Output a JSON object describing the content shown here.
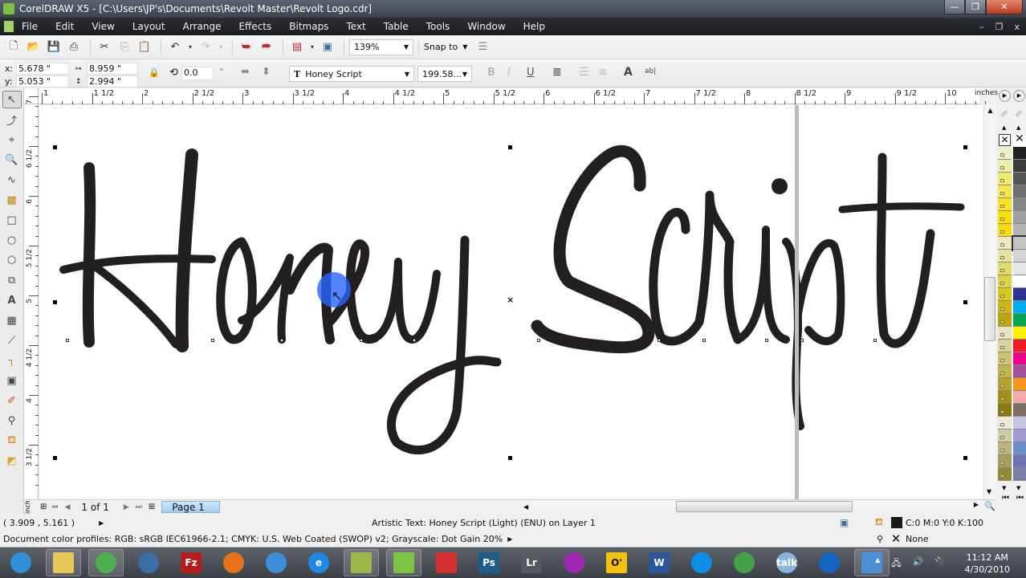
{
  "window": {
    "title": "CorelDRAW X5 - [C:\\Users\\JP's\\Documents\\Revolt Master\\Revolt Logo.cdr]",
    "minimize": "—",
    "maximize": "❐",
    "close": "✕"
  },
  "menu": {
    "items": [
      "File",
      "Edit",
      "View",
      "Layout",
      "Arrange",
      "Effects",
      "Bitmaps",
      "Text",
      "Table",
      "Tools",
      "Window",
      "Help"
    ],
    "doc_controls": [
      "–",
      "❐",
      "x"
    ]
  },
  "toolbar": {
    "icons": [
      "new-icon",
      "open-icon",
      "save-icon",
      "print-icon",
      "cut-icon",
      "copy-icon",
      "paste-icon",
      "undo-icon",
      "redo-icon",
      "import-icon",
      "export-icon",
      "application-launcher-icon",
      "welcome-screen-icon"
    ],
    "zoom_level": "139%",
    "snap_to": "Snap to"
  },
  "property_bar": {
    "x_label": "x:",
    "x_value": "5.678 \"",
    "y_label": "y:",
    "y_value": "5.053 \"",
    "width_value": "8.959 \"",
    "height_value": "2.994 \"",
    "rotation_value": "0.0",
    "degree_symbol": "°",
    "font_name": "Honey Script",
    "font_size": "199.58..."
  },
  "ruler": {
    "h_labels": [
      "1",
      "1 1/2",
      "2",
      "2 1/2",
      "3",
      "3 1/2",
      "4",
      "4 1/2",
      "5",
      "5 1/2",
      "6",
      "6 1/2",
      "7",
      "7 1/2",
      "8",
      "8 1/2",
      "9",
      "9 1/2",
      "10"
    ],
    "v_labels": [
      "7",
      "6 1/2",
      "6",
      "5 1/2",
      "5",
      "4 1/2",
      "4",
      "3 1/2"
    ],
    "units": "inches"
  },
  "canvas": {
    "artistic_text": "Honey Script",
    "word1": "Honey",
    "word2": "Script",
    "text_color": "#231f20"
  },
  "tools": [
    "pick-tool",
    "shape-tool",
    "crop-tool",
    "zoom-tool",
    "freehand-tool",
    "smart-fill-tool",
    "rectangle-tool",
    "ellipse-tool",
    "polygon-tool",
    "basic-shapes-tool",
    "text-tool",
    "table-tool",
    "dimension-tool",
    "connector-tool",
    "blend-tool",
    "eyedropper-tool",
    "outline-tool",
    "fill-tool",
    "interactive-fill-tool"
  ],
  "palette": {
    "col1": [
      "#f1f1c9",
      "#eeeea0",
      "#f0ec70",
      "#f4e94a",
      "#f8e31c",
      "#fbe000",
      "#fddc00",
      "#eceac0",
      "#e6e49a",
      "#e1dc6a",
      "#ddd348",
      "#d8c91e",
      "#cbb814",
      "#bda50a",
      "#e8e6c2",
      "#d9d49a",
      "#cdc46e",
      "#c2b548",
      "#b5a32a",
      "#a39114",
      "#8c7b0a",
      "#ecebd8",
      "#cfcca2",
      "#bdb67c",
      "#a8a05a",
      "#948a36"
    ],
    "col2": [
      "#231f20",
      "#3c3c3c",
      "#555555",
      "#6e6e6e",
      "#878787",
      "#a0a0a0",
      "#b4b4b4",
      "#c3c3c3",
      "#d4d4d4",
      "#e6e6e6",
      "#ffffff",
      "#2e3192",
      "#00aeef",
      "#00a651",
      "#fff200",
      "#ed1c24",
      "#ec008c",
      "#a3509f",
      "#f7941d",
      "#f5a9a9",
      "#7d6f62",
      "#c7c5e2",
      "#9f9ccf",
      "#6a8fcb",
      "#6d72b2",
      "#7b7fa8"
    ]
  },
  "page_nav": {
    "counter": "1 of 1",
    "tab": "Page 1"
  },
  "status": {
    "cursor_coords": "( 3.909 , 5.161 )",
    "object_info": "Artistic Text: Honey Script (Light) (ENU) on Layer 1",
    "fill_info": "C:0 M:0 Y:0 K:100",
    "outline_info": "None",
    "color_profiles": "Document color profiles: RGB: sRGB IEC61966-2.1; CMYK: U.S. Web Coated (SWOP) v2; Grayscale: Dot Gain 20%"
  },
  "taskbar": {
    "apps": [
      {
        "name": "start",
        "label": "",
        "color": "#2f8fd8",
        "open": false
      },
      {
        "name": "explorer",
        "label": "",
        "color": "#e8c65a",
        "open": true
      },
      {
        "name": "chrome",
        "label": "",
        "color": "#4caf50",
        "open": true
      },
      {
        "name": "thunderbird",
        "label": "",
        "color": "#3a6ea5",
        "open": false
      },
      {
        "name": "filezilla",
        "label": "Fz",
        "color": "#b71c1c",
        "open": false
      },
      {
        "name": "firefox",
        "label": "",
        "color": "#e8711c",
        "open": false
      },
      {
        "name": "safari",
        "label": "",
        "color": "#3d8ed6",
        "open": false
      },
      {
        "name": "internet-explorer",
        "label": "e",
        "color": "#1e88e5",
        "open": false
      },
      {
        "name": "corel-capture",
        "label": "",
        "color": "#9cb84a",
        "open": true
      },
      {
        "name": "coreldraw",
        "label": "",
        "color": "#7dc242",
        "open": true
      },
      {
        "name": "photo-app",
        "label": "",
        "color": "#d32f2f",
        "open": false
      },
      {
        "name": "photoshop",
        "label": "Ps",
        "color": "#1f5c8a",
        "open": false
      },
      {
        "name": "lightroom",
        "label": "Lr",
        "color": "#555a60",
        "open": false
      },
      {
        "name": "picasa",
        "label": "",
        "color": "#9c27b0",
        "open": false
      },
      {
        "name": "oreilly",
        "label": "O'",
        "color": "#f4c20d",
        "open": false
      },
      {
        "name": "word",
        "label": "W",
        "color": "#2b579a",
        "open": false
      },
      {
        "name": "teamviewer",
        "label": "",
        "color": "#0e8ee9",
        "open": false
      },
      {
        "name": "messenger",
        "label": "",
        "color": "#43a047",
        "open": false
      },
      {
        "name": "google-talk",
        "label": "talk",
        "color": "#8ab4e0",
        "open": false
      },
      {
        "name": "feedreader",
        "label": "",
        "color": "#1565c0",
        "open": false
      },
      {
        "name": "control-panel",
        "label": "",
        "color": "#4a90d9",
        "open": true
      }
    ],
    "time": "11:12 AM",
    "date": "4/30/2010"
  }
}
